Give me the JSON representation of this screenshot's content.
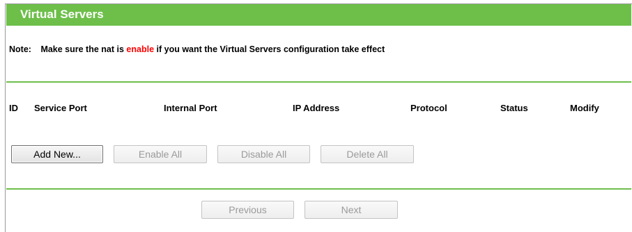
{
  "header": {
    "title": "Virtual Servers"
  },
  "note": {
    "label": "Note:",
    "text_before": "Make sure the nat is",
    "highlight": "enable",
    "text_after": "if you want the Virtual Servers configuration take effect",
    "highlight_color": "#ff0000"
  },
  "table": {
    "columns": [
      "ID",
      "Service Port",
      "Internal Port",
      "IP Address",
      "Protocol",
      "Status",
      "Modify"
    ],
    "rows": []
  },
  "actions": {
    "add_new": "Add New...",
    "enable_all": "Enable All",
    "disable_all": "Disable All",
    "delete_all": "Delete All"
  },
  "pagination": {
    "previous": "Previous",
    "next": "Next"
  },
  "colors": {
    "accent": "#6dbf4a",
    "disabled_text": "#9a9a9a"
  }
}
